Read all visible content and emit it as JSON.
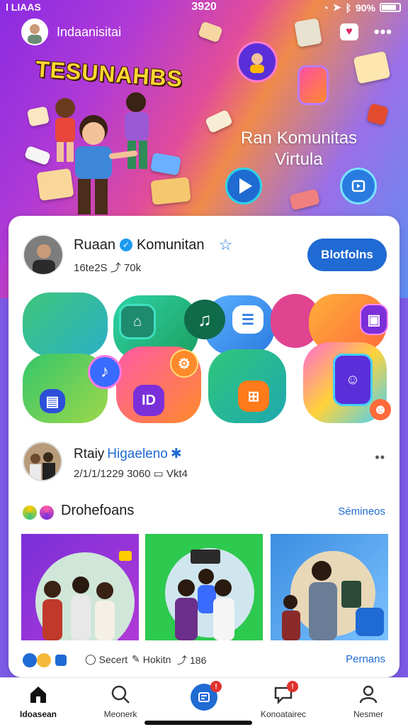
{
  "status_bar": {
    "left": "l LIAAS",
    "time": "3920",
    "battery": "90%"
  },
  "header": {
    "username": "Indaanisitai"
  },
  "hero": {
    "title": "TESUNAHBS",
    "subtitle_line1": "Ran Komunitas",
    "subtitle_line2": "Virtula"
  },
  "community": {
    "name": "Ruaan",
    "name_suffix": "Komunitan",
    "meta": "16te2S",
    "share_count": "70k",
    "follow_label": "Blotfolns"
  },
  "post": {
    "name": "Rtaiy",
    "name_blue": "Higaeleno",
    "timestamp": "2/1/1/1229 3060",
    "comments_label": "Vkt4"
  },
  "section": {
    "title": "Drohefoans",
    "link": "Sémineos"
  },
  "actions": {
    "comment_label": "Secert",
    "edit_label": "Hokitn",
    "share_count": "186",
    "link": "Pernans"
  },
  "tabs": [
    {
      "label": "Idoasean"
    },
    {
      "label": "Meonerk"
    },
    {
      "label": ""
    },
    {
      "label": "Konoatairec"
    },
    {
      "label": "Nesmer"
    }
  ],
  "colors": {
    "accent": "#1f6ad3",
    "badge": "#e0322e"
  }
}
